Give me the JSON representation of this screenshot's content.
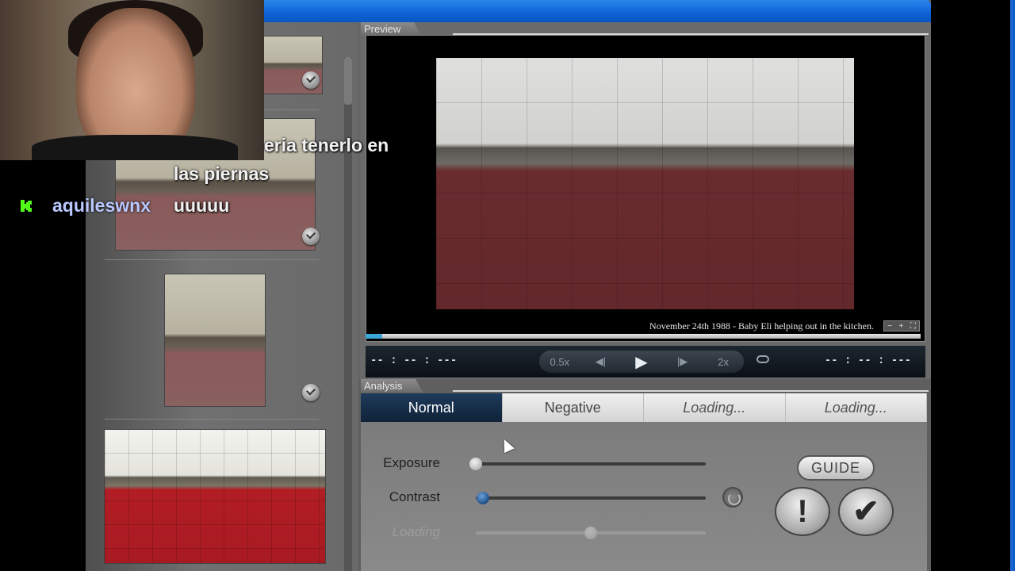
{
  "preview": {
    "section_label": "Preview",
    "caption": "November 24th 1988 - Baby Eli helping out in the kitchen.",
    "zoom_controls": [
      "−",
      "+",
      "⛶"
    ],
    "time_elapsed": "-- : -- : ---",
    "time_total": "-- : -- : ---",
    "progress_fraction": 0.03,
    "transport": {
      "slow": "0.5x",
      "step_back": "◀|",
      "play": "▶",
      "step_forward": "|▶",
      "fast": "2x"
    }
  },
  "analysis": {
    "section_label": "Analysis",
    "tabs": [
      {
        "label": "Normal",
        "active": true
      },
      {
        "label": "Negative",
        "active": false
      },
      {
        "label": "Loading...",
        "active": false
      },
      {
        "label": "Loading...",
        "active": false
      }
    ],
    "sliders": [
      {
        "label": "Exposure",
        "value": 0.0
      },
      {
        "label": "Contrast",
        "value": 0.03
      },
      {
        "label": "Loading",
        "value": 0.5
      }
    ],
    "guide_label": "GUIDE",
    "warning_symbol": "!",
    "confirm_symbol": "✔"
  },
  "overlay": {
    "chat_line_1": "eria tenerlo en",
    "chat_line_2": "las piernas",
    "chat_username": "aquileswnx",
    "chat_message": "uuuuu",
    "username_color": "#b9c8ff",
    "kick_color": "#53fc18"
  },
  "colors": {
    "title_bar": "#0e62d6",
    "active_tab": "#1f3a5c",
    "progress": "#3da6d8"
  }
}
